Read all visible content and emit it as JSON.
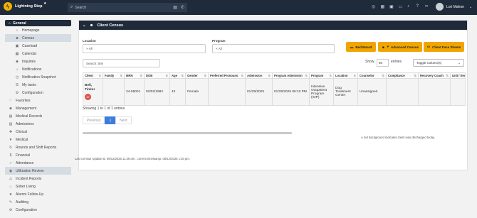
{
  "topbar": {
    "brand": "Lightning Step",
    "search_placeholder": "Search",
    "user_name": "Lori Mahon",
    "icons": [
      "eye-slash-icon",
      "calendar-icon",
      "grid-icon",
      "chat-icon",
      "bell-icon",
      "help-icon",
      "link-icon"
    ]
  },
  "sidebar": {
    "group": "General",
    "items": [
      {
        "label": "Homepage",
        "icon": "home-icon",
        "sub": true
      },
      {
        "label": "Census",
        "icon": "users-icon",
        "sub": true,
        "active": true
      },
      {
        "label": "Caseload",
        "icon": "briefcase-icon",
        "sub": true
      },
      {
        "label": "Calendar",
        "icon": "calendar-icon",
        "sub": true
      },
      {
        "label": "Inquiries",
        "icon": "users-icon",
        "sub": true
      },
      {
        "label": "Notifications",
        "icon": "bell-icon",
        "sub": true
      },
      {
        "label": "Notification Snapshot",
        "icon": "clock-icon",
        "sub": true
      },
      {
        "label": "My tasks",
        "icon": "tasks-icon",
        "sub": true
      },
      {
        "label": "Configuration",
        "icon": "gear-icon",
        "sub": true
      },
      {
        "label": "Favorites",
        "icon": "heart-icon"
      },
      {
        "label": "Management",
        "icon": "users-icon"
      },
      {
        "label": "Medical Records",
        "icon": "records-icon"
      },
      {
        "label": "Admissions",
        "icon": "admissions-icon"
      },
      {
        "label": "Clinical",
        "icon": "clinical-icon"
      },
      {
        "label": "Medical",
        "icon": "medical-icon"
      },
      {
        "label": "Rounds and Shift Reports",
        "icon": "rounds-icon"
      },
      {
        "label": "Financial",
        "icon": "financial-icon"
      },
      {
        "label": "Attendance",
        "icon": "attendance-icon"
      },
      {
        "label": "Utilization Review",
        "icon": "review-icon",
        "active": true
      },
      {
        "label": "Incident Reports",
        "icon": "incident-icon"
      },
      {
        "label": "Sober Living",
        "icon": "home-icon"
      },
      {
        "label": "Alumni Follow-Up",
        "icon": "alumni-icon"
      },
      {
        "label": "Auditing",
        "icon": "auditing-icon"
      },
      {
        "label": "Configuration",
        "icon": "gear-icon"
      }
    ]
  },
  "panel": {
    "title": "Client Census",
    "location_label": "Location",
    "location_value": "× All",
    "program_label": "Program",
    "program_value": "× All",
    "buttons": [
      "Bed Board",
      "Advanced Census",
      "Client Face Sheets"
    ],
    "search_label": "Search:",
    "search_value": "tink",
    "show_label": "Show",
    "show_value": "50",
    "entries_label": "entries",
    "toggle_label": "Toggle Column(s)",
    "columns": [
      "Client",
      "Family",
      "MRN",
      "DOB",
      "Age",
      "Gender",
      "Preferred Pronouns",
      "Admission",
      "Program Admission",
      "Program",
      "Location",
      "Counselor",
      "Compliance",
      "Recovery Coach",
      "Unit / Bed"
    ],
    "rows": [
      {
        "client": "Bell, Tinker",
        "badge": "47",
        "family": "",
        "mrn": "24-06001",
        "dob": "02/02/1982",
        "age": "43",
        "gender": "Female",
        "pronouns": "",
        "admission": "01/29/2025",
        "program_admission": "01/29/2025 05:10 PM",
        "program": "Intensive Outpatient Program (IOP)",
        "location": "Dog Treatment Center",
        "counselor": "Unassigned",
        "compliance": "",
        "recovery_coach": "",
        "unit": ""
      }
    ],
    "info": "Showing 1 to 1 of 1 entries",
    "pager": {
      "previous": "Previous",
      "current": "1",
      "next": "Next"
    },
    "note": "A red background indicates client was discharged today."
  },
  "footer": "Last Census Update at: 08/12/2025 11:39 am , current timestamp: 08/12/2025 1:30 pm.",
  "colors": {
    "topbar": "#1f2a3a",
    "accent": "#f0a500",
    "active": "#d6dce3",
    "pager": "#3b7ddd"
  }
}
